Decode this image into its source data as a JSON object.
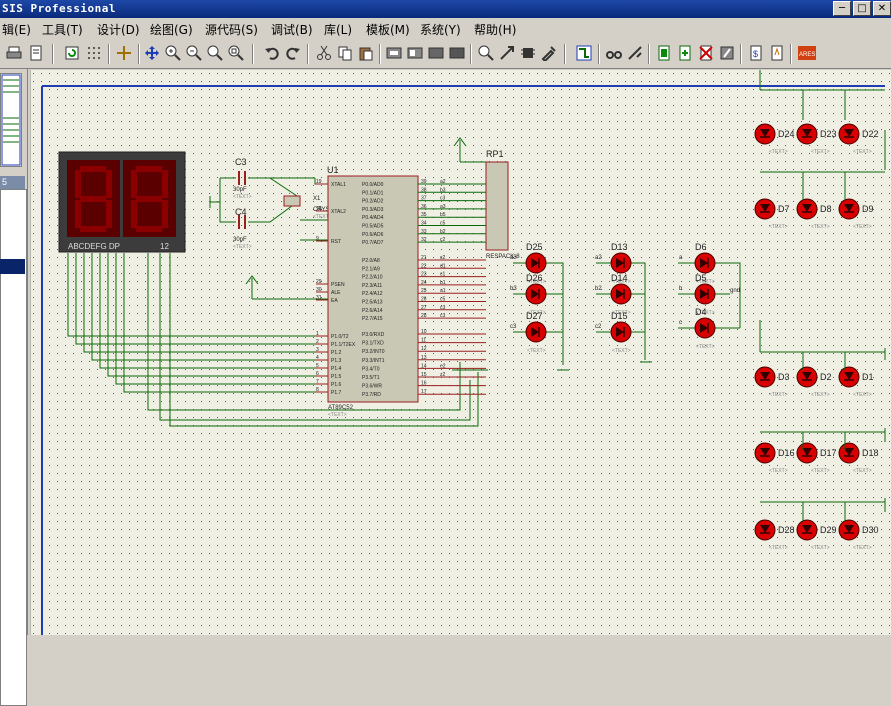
{
  "window": {
    "title": "SIS Professional"
  },
  "menu": [
    {
      "label": "辑(E)"
    },
    {
      "label": "工具(T)"
    },
    {
      "label": "设计(D)"
    },
    {
      "label": "绘图(G)"
    },
    {
      "label": "源代码(S)"
    },
    {
      "label": "调试(B)"
    },
    {
      "label": "库(L)"
    },
    {
      "label": "模板(M)"
    },
    {
      "label": "系统(Y)"
    },
    {
      "label": "帮助(H)"
    }
  ],
  "toolbar": {
    "icons": [
      "print-icon",
      "page-icon",
      "refresh-icon",
      "grid-icon",
      "origin-icon",
      "pan-icon",
      "zoom-in-icon",
      "zoom-out-icon",
      "zoom-all-icon",
      "zoom-area-icon",
      "undo-icon",
      "redo-icon",
      "cut-icon",
      "copy-icon",
      "paste-icon",
      "block-copy-icon",
      "block-move-icon",
      "block-rotate-icon",
      "block-delete-icon",
      "pick-device-icon",
      "make-device-icon",
      "packaging-icon",
      "decompose-icon",
      "wire-autorouter-icon",
      "search-icon",
      "property-tool-icon",
      "new-sheet-icon",
      "remove-sheet-icon",
      "bill-of-materials-icon",
      "netlist-icon",
      "electrical-check-icon",
      "ares-icon"
    ],
    "ares_label": "ARES"
  },
  "left_panel": {
    "tab_label": "5"
  },
  "schematic": {
    "display": {
      "label": "ABCDEFG  DP",
      "pins": "12"
    },
    "crystal": {
      "ref": "C3",
      "value": "30pF",
      "ref2": "C4",
      "value2": "30pF",
      "xtal": "X1",
      "xtal_value": "CRYSTAL",
      "text": "<TEXT>"
    },
    "mcu": {
      "ref": "U1",
      "part": "AT89C52",
      "text": "<TEXT>",
      "left_pins": [
        {
          "num": "19",
          "name": "XTAL1"
        },
        {
          "num": "18",
          "name": "XTAL2"
        },
        {
          "num": "9",
          "name": "RST"
        },
        {
          "num": "29",
          "name": "PSEN"
        },
        {
          "num": "30",
          "name": "ALE"
        },
        {
          "num": "31",
          "name": "EA"
        },
        {
          "num": "1",
          "name": "P1.0/T2"
        },
        {
          "num": "2",
          "name": "P1.1/T2EX"
        },
        {
          "num": "3",
          "name": "P1.2"
        },
        {
          "num": "4",
          "name": "P1.3"
        },
        {
          "num": "5",
          "name": "P1.4"
        },
        {
          "num": "6",
          "name": "P1.5"
        },
        {
          "num": "7",
          "name": "P1.6"
        },
        {
          "num": "8",
          "name": "P1.7"
        }
      ],
      "right_pins": [
        {
          "num": "39",
          "name": "P0.0/AD0",
          "net": "a2"
        },
        {
          "num": "38",
          "name": "P0.1/AD1",
          "net": "b3"
        },
        {
          "num": "37",
          "name": "P0.2/AD2",
          "net": "c3"
        },
        {
          "num": "36",
          "name": "P0.3/AD3",
          "net": "a3"
        },
        {
          "num": "35",
          "name": "P0.4/AD4",
          "net": "b5"
        },
        {
          "num": "34",
          "name": "P0.5/AD5",
          "net": "c5"
        },
        {
          "num": "33",
          "name": "P0.6/AD6",
          "net": "b2"
        },
        {
          "num": "32",
          "name": "P0.7/AD7",
          "net": "c2"
        },
        {
          "num": "21",
          "name": "P2.0/A8",
          "net": "c2"
        },
        {
          "num": "22",
          "name": "P2.1/A9",
          "net": "d1"
        },
        {
          "num": "23",
          "name": "P2.2/A10",
          "net": "c1"
        },
        {
          "num": "24",
          "name": "P2.3/A11",
          "net": "b1"
        },
        {
          "num": "25",
          "name": "P2.4/A12",
          "net": "a1"
        },
        {
          "num": "26",
          "name": "P2.5/A13",
          "net": "c5"
        },
        {
          "num": "27",
          "name": "P2.6/A14",
          "net": "c3"
        },
        {
          "num": "28",
          "name": "P2.7/A15",
          "net": "c3"
        },
        {
          "num": "10",
          "name": "P3.0/RXD",
          "net": ""
        },
        {
          "num": "11",
          "name": "P3.1/TXD",
          "net": ""
        },
        {
          "num": "12",
          "name": "P3.2/INT0",
          "net": ""
        },
        {
          "num": "13",
          "name": "P3.3/INT1",
          "net": ""
        },
        {
          "num": "14",
          "name": "P3.4/T0",
          "net": "e2"
        },
        {
          "num": "15",
          "name": "P3.5/T1",
          "net": "z2"
        },
        {
          "num": "16",
          "name": "P3.6/WR",
          "net": ""
        },
        {
          "num": "17",
          "name": "P3.7/RD",
          "net": ""
        }
      ]
    },
    "resistor_pack": {
      "ref": "RP1",
      "part": "RESPACK-8"
    },
    "leds": [
      {
        "ref": "D25",
        "net": "a3",
        "stamp": "<TEXT>"
      },
      {
        "ref": "D26",
        "net": "b3",
        "stamp": "<TEXT>"
      },
      {
        "ref": "D27",
        "net": "c3",
        "stamp": "<TEXT>"
      },
      {
        "ref": "D13",
        "net": "a2",
        "stamp": "<TEXT>"
      },
      {
        "ref": "D14",
        "net": "b2",
        "stamp": "<TEXT>"
      },
      {
        "ref": "D15",
        "net": "c2",
        "stamp": "<TEXT>"
      },
      {
        "ref": "D6",
        "net": "a",
        "stamp": "<TEXT>"
      },
      {
        "ref": "D5",
        "net": "b",
        "stamp": "<TEXT>"
      },
      {
        "ref": "D4",
        "net": "c",
        "stamp": "<TEXT>"
      },
      {
        "ref": "D24",
        "net": "",
        "stamp": "<TEXT>"
      },
      {
        "ref": "D23",
        "net": "",
        "stamp": "<TEXT>"
      },
      {
        "ref": "D22",
        "net": "",
        "stamp": "<TEXT>"
      },
      {
        "ref": "D7",
        "net": "",
        "stamp": "<TEXT>"
      },
      {
        "ref": "D8",
        "net": "",
        "stamp": "<TEXT>"
      },
      {
        "ref": "D9",
        "net": "",
        "stamp": "<TEXT>"
      },
      {
        "ref": "D3",
        "net": "",
        "stamp": "<TEXT>"
      },
      {
        "ref": "D2",
        "net": "",
        "stamp": "<TEXT>"
      },
      {
        "ref": "D1",
        "net": "",
        "stamp": "<TEXT>"
      },
      {
        "ref": "D16",
        "net": "",
        "stamp": "<TEXT>"
      },
      {
        "ref": "D17",
        "net": "",
        "stamp": "<TEXT>"
      },
      {
        "ref": "D18",
        "net": "",
        "stamp": "<TEXT>"
      },
      {
        "ref": "D28",
        "net": "",
        "stamp": "<TEXT>"
      },
      {
        "ref": "D29",
        "net": "",
        "stamp": "<TEXT>"
      },
      {
        "ref": "D30",
        "net": "",
        "stamp": "<TEXT>"
      }
    ],
    "gnd_label": "gnd"
  },
  "colors": {
    "titlebar": "#0a2a7a",
    "canvas": "#f0efe4",
    "sheet_border": "#1e3cb4",
    "component_fill": "#c8c8b4",
    "component_line": "#9a1e1e",
    "wire": "#0a6a0a",
    "led": "#cc0000",
    "display_bg": "#3c3c3c",
    "segment": "#7a0000"
  }
}
